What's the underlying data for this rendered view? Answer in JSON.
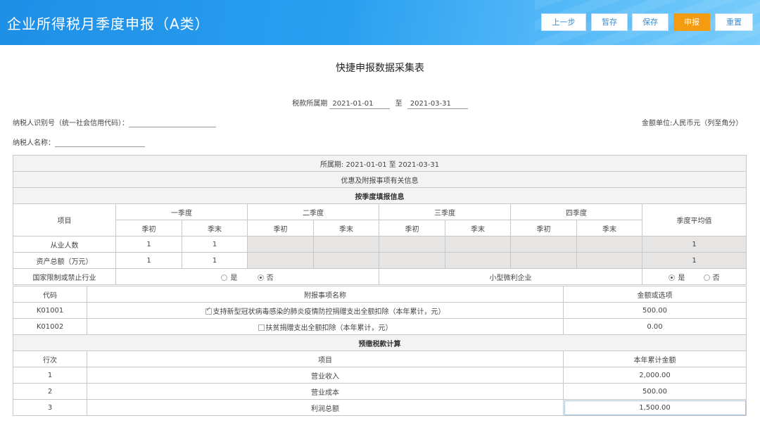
{
  "header": {
    "title": "企业所得税月季度申报（A类）",
    "buttons": {
      "prev": "上一步",
      "temp_save": "暂存",
      "save": "保存",
      "submit": "申报",
      "reset": "重置"
    }
  },
  "form": {
    "title": "快捷申报数据采集表",
    "period_label": "税款所属期",
    "period_start": "2021-01-01",
    "period_to": "至",
    "period_end": "2021-03-31",
    "taxpayer_id_label": "纳税人识别号（统一社会信用代码）：",
    "taxpayer_name_label": "纳税人名称：",
    "currency_note": "金额单位:人民币元（列至角分）"
  },
  "table1": {
    "period_text": "所属期: 2021-01-01 至 2021-03-31",
    "section_title": "优惠及附报事项有关信息",
    "quarter_section": "按季度填报信息",
    "col_item": "项目",
    "quarters": [
      "一季度",
      "二季度",
      "三季度",
      "四季度"
    ],
    "begin": "季初",
    "end": "季末",
    "avg": "季度平均值",
    "rows": [
      {
        "label": "从业人数",
        "q1_begin": "1",
        "q1_end": "1",
        "avg": "1"
      },
      {
        "label": "资产总额（万元）",
        "q1_begin": "1",
        "q1_end": "1",
        "avg": "1"
      }
    ],
    "restricted_label": "国家限制或禁止行业",
    "yes": "是",
    "no": "否",
    "small_profit_label": "小型微利企业"
  },
  "table2": {
    "col_code": "代码",
    "col_name": "附报事项名称",
    "col_amount": "金额或选项",
    "rows": [
      {
        "code": "K01001",
        "name": "支持新型冠状病毒感染的肺炎疫情防控捐赠支出全额扣除（本年累计，元）",
        "amount": "500.00"
      },
      {
        "code": "K01002",
        "name": "扶贫捐赠支出全额扣除（本年累计，元）",
        "amount": "0.00"
      }
    ],
    "calc_section": "预缴税款计算",
    "col_line": "行次",
    "col_item": "项目",
    "col_ytd": "本年累计金额",
    "calc_rows": [
      {
        "line": "1",
        "item": "营业收入",
        "amount": "2,000.00"
      },
      {
        "line": "2",
        "item": "营业成本",
        "amount": "500.00"
      },
      {
        "line": "3",
        "item": "利润总额",
        "amount": "1,500.00"
      }
    ]
  },
  "colors": {
    "header_blue": "#1e8fe6",
    "accent_orange": "#f39c12",
    "disabled_grey": "#e7e4e4"
  }
}
